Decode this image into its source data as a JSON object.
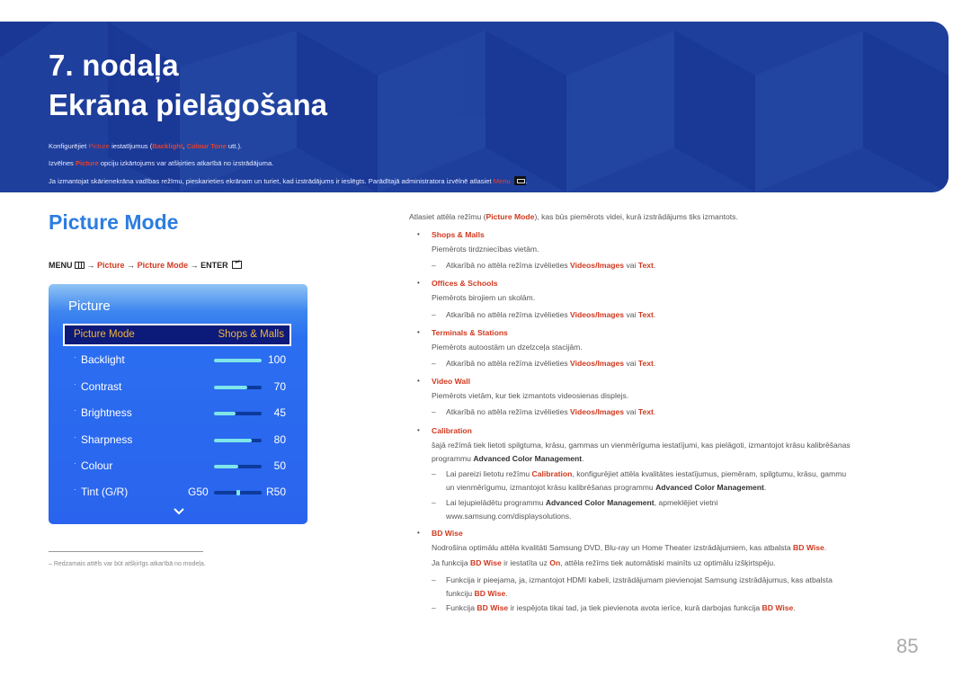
{
  "banner": {
    "chapter": "7. nodaļa",
    "title": "Ekrāna pielāgošana",
    "line1": {
      "pre": "Konfigurējiet ",
      "picture": "Picture",
      "mid": " iestatījumus (",
      "backlight": "Backlight",
      "comma": ", ",
      "colour_tone": "Colour Tone",
      "post": " utt.)."
    },
    "line2": {
      "pre": "Izvēlnes ",
      "picture": "Picture",
      "post": " opciju izkārtojums var atšķirties atkarībā no izstrādājuma."
    },
    "line3": {
      "pre": "Ja izmantojat skārienekrāna vadības režīmu, pieskarieties ekrānam un turiet, kad izstrādājums ir ieslēgts. Parādītajā administratora izvēlnē atlasiet ",
      "menu": "Menu",
      "post": "."
    },
    "icons": {
      "menu_key": "menu-key-icon"
    }
  },
  "section": {
    "title": "Picture Mode",
    "path": {
      "menu": "MENU",
      "arrow": " → ",
      "picture": "Picture",
      "picture_mode": "Picture Mode",
      "enter": "ENTER"
    }
  },
  "osd": {
    "title": "Picture",
    "selected": {
      "label": "Picture Mode",
      "value": "Shops & Malls"
    },
    "rows": [
      {
        "name": "Backlight",
        "value": "100",
        "level": 100
      },
      {
        "name": "Contrast",
        "value": "70",
        "level": 70
      },
      {
        "name": "Brightness",
        "value": "45",
        "level": 45
      },
      {
        "name": "Sharpness",
        "value": "80",
        "level": 80
      },
      {
        "name": "Colour",
        "value": "50",
        "level": 50
      }
    ],
    "tint": {
      "name": "Tint (G/R)",
      "left": "G50",
      "right": "R50",
      "level": 50
    },
    "dot": "·",
    "colors": {
      "panel": "#2a64ee",
      "selected_bg": "#0c1a7a",
      "selected_text": "#f0b53c",
      "bar_fill": "#7fe6ea",
      "bar_track": "#0d3a9c"
    }
  },
  "footnote": "–  Redzamais attēls var būt atšķirīgs atkarībā no modeļa.",
  "content": {
    "intro": {
      "pre": "Atlasiet attēla režīmu (",
      "mode": "Picture Mode",
      "post": "), kas būs piemērots videi, kurā izstrādājums tiks izmantots."
    },
    "bullet": "•",
    "dash": "–",
    "common_note": {
      "pre": "Atkarībā no attēla režīma izvēlieties ",
      "vi": "Videos/Images",
      "mid": " vai ",
      "text": "Text",
      "post": "."
    },
    "items": [
      {
        "title": "Shops & Malls",
        "desc": "Piemērots tirdzniecības vietām."
      },
      {
        "title": "Offices & Schools",
        "desc": "Piemērots birojiem un skolām."
      },
      {
        "title": "Terminals & Stations",
        "desc": "Piemērots autoostām un dzelzceļa stacijām."
      },
      {
        "title": "Video Wall",
        "desc": "Piemērots vietām, kur tiek izmantots videosienas displejs."
      }
    ],
    "calibration": {
      "title": "Calibration",
      "desc1": "šajā režīmā tiek lietoti spilgtuma, krāsu, gammas un vienmērīguma iestatījumi, kas pielāgoti, izmantojot krāsu kalibrēšanas",
      "desc2_pre": "programmu ",
      "acm": "Advanced Color Management",
      "desc2_post": ".",
      "note1_pre": "Lai pareizi lietotu režīmu ",
      "note1_cal": "Calibration",
      "note1_post": ", konfigurējiet attēla kvalitātes iestatījumus, piemēram, spilgtumu, krāsu, gammu",
      "note1b_pre": "un vienmērīgumu, izmantojot krāsu kalibrēšanas programmu ",
      "note1b_post": ".",
      "note2_pre": "Lai lejupielādētu programmu ",
      "note2_post": ", apmeklējiet vietni",
      "note2b": "www.samsung.com/displaysolutions."
    },
    "bdwise": {
      "title": "BD Wise",
      "name": "BD Wise",
      "desc1_pre": "Nodrošina optimālu attēla kvalitāti Samsung DVD, Blu-ray un Home Theater izstrādājumiem, kas atbalsta ",
      "desc1_post": ".",
      "desc2_pre": "Ja funkcija ",
      "desc2_mid": " ir iestatīta uz ",
      "on": "On",
      "desc2_post": ", attēla režīms tiek automātiski mainīts uz optimālu izšķirtspēju.",
      "note1": "Funkcija ir pieejama, ja, izmantojot HDMI kabeli, izstrādājumam pievienojat Samsung izstrādājumus, kas atbalsta",
      "note1b_pre": "funkciju ",
      "note1b_post": ".",
      "note2_pre": "Funkcija ",
      "note2_mid": " ir iespējota tikai tad, ja tiek pievienota avota ierīce, kurā darbojas funkcija ",
      "note2_post": "."
    }
  },
  "page_number": "85",
  "colors": {
    "banner": "#1f3f9c",
    "accent_red": "#d0391f",
    "title_blue": "#2d7de0"
  }
}
